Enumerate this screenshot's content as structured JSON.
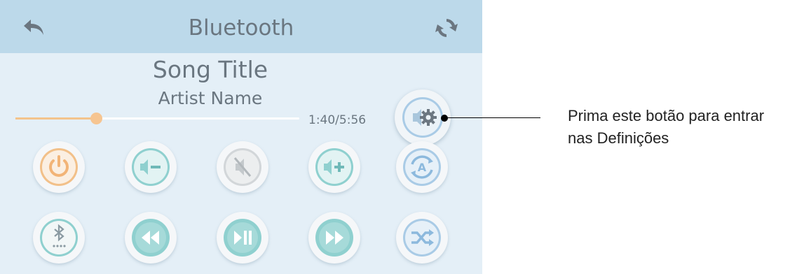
{
  "header": {
    "title": "Bluetooth"
  },
  "now_playing": {
    "song_title": "Song Title",
    "artist_name": "Artist Name",
    "time": "1:40/5:56",
    "progress": 0.285
  },
  "controls": {
    "row1": [
      {
        "name": "power-button",
        "icon": "power-icon",
        "color": "#f2c089"
      },
      {
        "name": "volume-down-button",
        "icon": "volume-down-icon",
        "color": "#8fd0cf"
      },
      {
        "name": "mute-button",
        "icon": "mute-icon",
        "color": "#d2d6d9"
      },
      {
        "name": "volume-up-button",
        "icon": "volume-up-icon",
        "color": "#8fd0cf"
      },
      {
        "name": "auto-mode-button",
        "icon": "auto-mode-icon",
        "color": "#a9cbe6"
      }
    ],
    "row2": [
      {
        "name": "bluetooth-button",
        "icon": "bluetooth-icon",
        "color": "#8fd0cf"
      },
      {
        "name": "rewind-button",
        "icon": "rewind-icon",
        "color": "#8fd0cf"
      },
      {
        "name": "play-pause-button",
        "icon": "play-pause-icon",
        "color": "#8fd0cf"
      },
      {
        "name": "fast-forward-button",
        "icon": "fast-forward-icon",
        "color": "#8fd0cf"
      },
      {
        "name": "shuffle-button",
        "icon": "shuffle-icon",
        "color": "#a9cbe6"
      }
    ]
  },
  "settings": {
    "icon": "speaker-gear-icon",
    "color": "#a9cbe6"
  },
  "annotation": {
    "line1": "Prima este botão para entrar",
    "line2": "nas Definições"
  }
}
